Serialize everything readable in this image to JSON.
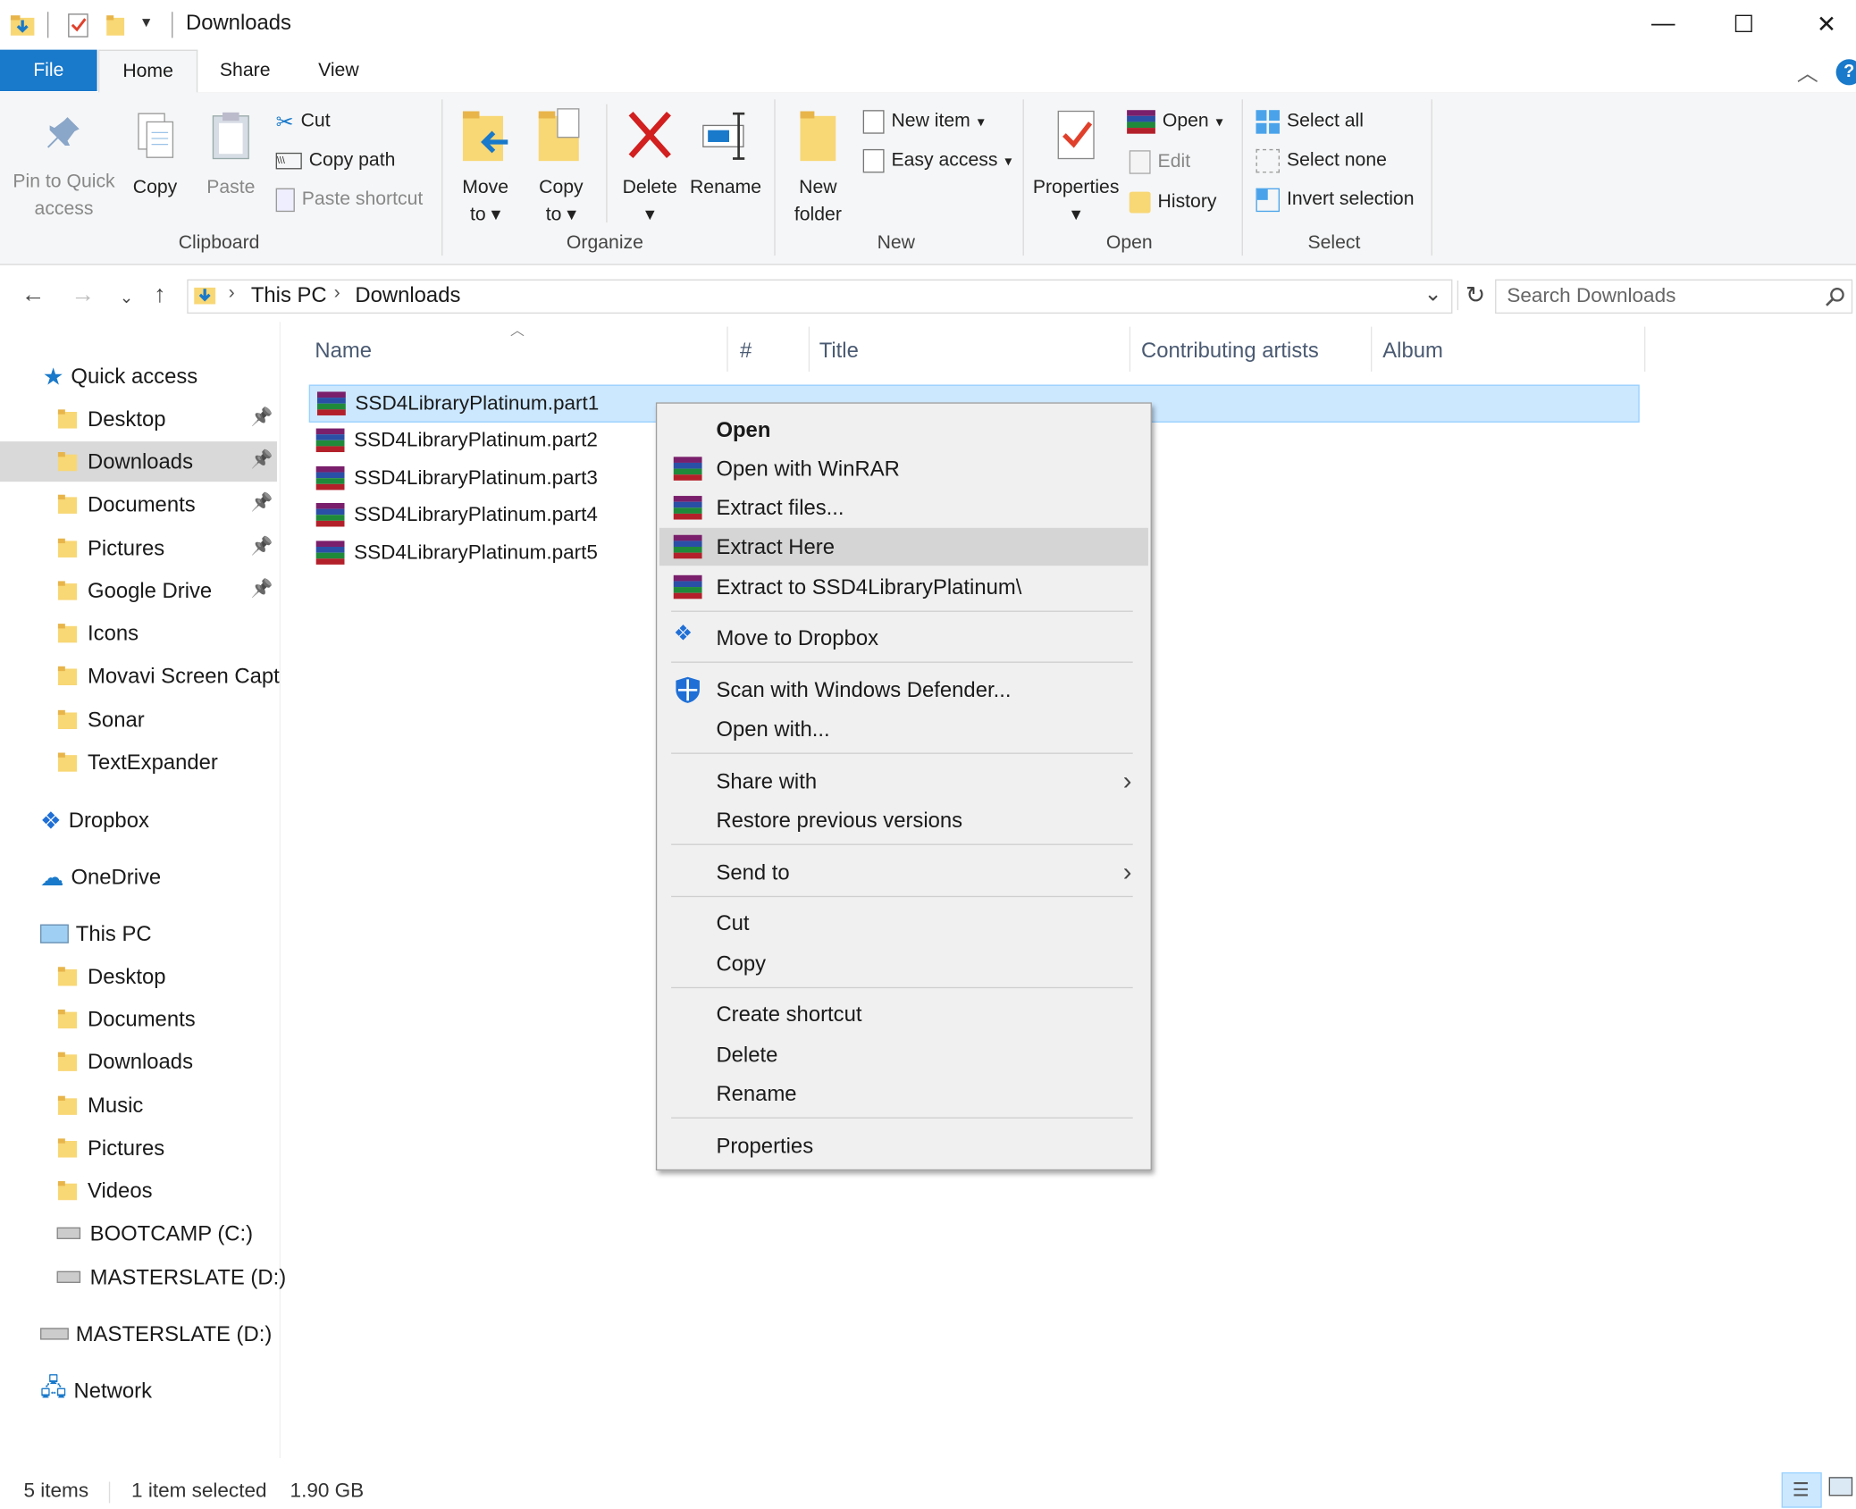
{
  "window": {
    "title": "Downloads",
    "controls": [
      "—",
      "☐",
      "✕"
    ]
  },
  "ribbon_tabs": [
    "File",
    "Home",
    "Share",
    "View"
  ],
  "ribbon": {
    "clipboard": {
      "label": "Clipboard",
      "pin": [
        "Pin to Quick",
        "access"
      ],
      "copy": "Copy",
      "paste": "Paste",
      "cut": "Cut",
      "copy_path": "Copy path",
      "paste_shortcut": "Paste shortcut"
    },
    "organize": {
      "label": "Organize",
      "move_to": [
        "Move",
        "to"
      ],
      "copy_to": [
        "Copy",
        "to"
      ],
      "delete": "Delete",
      "rename": "Rename"
    },
    "new": {
      "label": "New",
      "new_folder": [
        "New",
        "folder"
      ],
      "new_item": "New item",
      "easy_access": "Easy access"
    },
    "open": {
      "label": "Open",
      "properties": "Properties",
      "open": "Open",
      "edit": "Edit",
      "history": "History"
    },
    "select": {
      "label": "Select",
      "select_all": "Select all",
      "select_none": "Select none",
      "invert": "Invert selection"
    }
  },
  "address": {
    "crumbs": [
      "This PC",
      "Downloads"
    ],
    "search_placeholder": "Search Downloads"
  },
  "nav": {
    "quick_access": "Quick access",
    "quick_items": [
      "Desktop",
      "Downloads",
      "Documents",
      "Pictures",
      "Google Drive",
      "Icons",
      "Movavi Screen Capt",
      "Sonar",
      "TextExpander"
    ],
    "dropbox": "Dropbox",
    "onedrive": "OneDrive",
    "this_pc": "This PC",
    "pc_items": [
      "Desktop",
      "Documents",
      "Downloads",
      "Music",
      "Pictures",
      "Videos",
      "BOOTCAMP (C:)",
      "MASTERSLATE (D:)"
    ],
    "masterslate": "MASTERSLATE (D:)",
    "network": "Network"
  },
  "columns": [
    "Name",
    "#",
    "Title",
    "Contributing artists",
    "Album"
  ],
  "files": [
    "SSD4LibraryPlatinum.part1",
    "SSD4LibraryPlatinum.part2",
    "SSD4LibraryPlatinum.part3",
    "SSD4LibraryPlatinum.part4",
    "SSD4LibraryPlatinum.part5"
  ],
  "context_menu": {
    "open": "Open",
    "open_winrar": "Open with WinRAR",
    "extract_files": "Extract files...",
    "extract_here": "Extract Here",
    "extract_to": "Extract to SSD4LibraryPlatinum\\",
    "move_dropbox": "Move to Dropbox",
    "scan": "Scan with Windows Defender...",
    "open_with": "Open with...",
    "share_with": "Share with",
    "restore": "Restore previous versions",
    "send_to": "Send to",
    "cut": "Cut",
    "copy": "Copy",
    "create_shortcut": "Create shortcut",
    "delete": "Delete",
    "rename": "Rename",
    "properties": "Properties"
  },
  "status": {
    "items": "5 items",
    "selected": "1 item selected",
    "size": "1.90 GB"
  },
  "colors": {
    "accent": "#1979ca",
    "selection": "#cce8ff",
    "menu_bg": "#f0f0f0",
    "folder": "#f8d775"
  }
}
